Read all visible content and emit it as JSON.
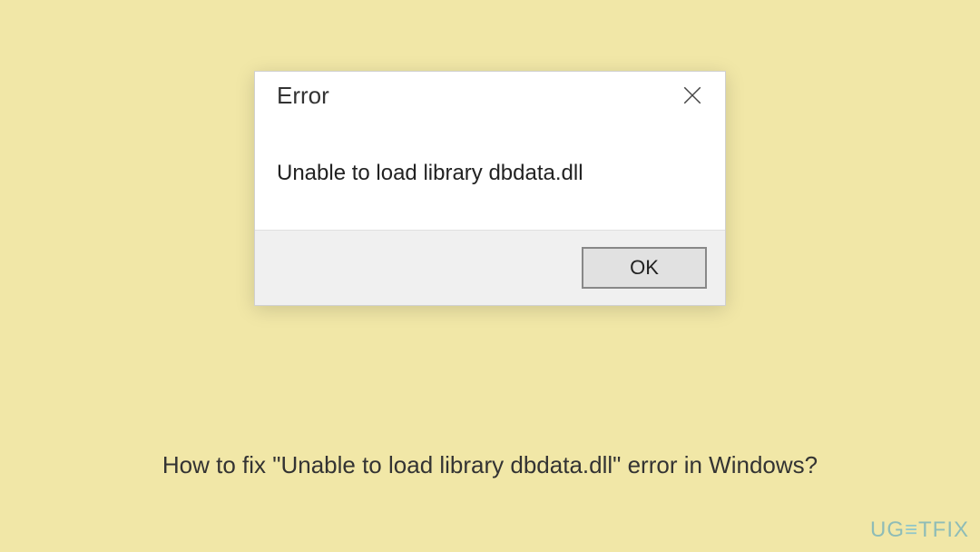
{
  "dialog": {
    "title": "Error",
    "message": "Unable to load library dbdata.dll",
    "ok_label": "OK"
  },
  "caption": "How to fix \"Unable to load library dbdata.dll\" error in Windows?",
  "watermark": {
    "part1": "UG",
    "part2": "≡",
    "part3": "TFIX"
  }
}
